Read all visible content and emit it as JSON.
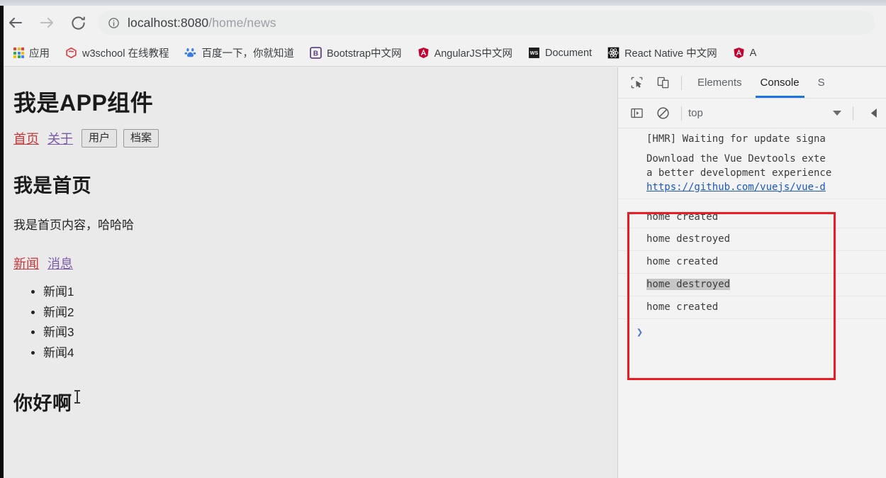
{
  "browser": {
    "back_label": "back-navigation",
    "forward_label": "forward-navigation",
    "reload_label": "reload",
    "url_host": "localhost:8080",
    "url_path": "/home/news",
    "url_full": "localhost:8080/home/news",
    "site_info_label": "site-information"
  },
  "bookmarks": [
    {
      "label": "应用",
      "icon": "apps-grid-icon"
    },
    {
      "label": "w3school 在线教程",
      "icon": "w3school-icon"
    },
    {
      "label": "百度一下，你就知道",
      "icon": "baidu-icon"
    },
    {
      "label": "Bootstrap中文网",
      "icon": "bootstrap-icon"
    },
    {
      "label": "AngularJS中文网",
      "icon": "angularjs-icon"
    },
    {
      "label": "Document",
      "icon": "ws-document-icon"
    },
    {
      "label": "React Native 中文网",
      "icon": "react-native-icon"
    },
    {
      "label": "A",
      "icon": "angularjs-icon"
    }
  ],
  "page": {
    "app_title": "我是APP组件",
    "nav_links": [
      {
        "label": "首页",
        "state": "visited-red"
      },
      {
        "label": "关于",
        "state": "visited-purple"
      }
    ],
    "nav_buttons": [
      {
        "label": "用户"
      },
      {
        "label": "档案"
      }
    ],
    "home_heading": "我是首页",
    "home_paragraph": "我是首页内容，哈哈哈",
    "sub_links": [
      {
        "label": "新闻",
        "state": "visited-red"
      },
      {
        "label": "消息",
        "state": "visited-purple"
      }
    ],
    "news_items": [
      "新闻1",
      "新闻2",
      "新闻3",
      "新闻4"
    ],
    "hello_heading": "你好啊"
  },
  "devtools": {
    "tabs": [
      {
        "label": "Elements",
        "active": false
      },
      {
        "label": "Console",
        "active": true
      },
      {
        "label": "S",
        "active": false
      }
    ],
    "inspect_icon": "inspect-element-icon",
    "device_toggle_icon": "device-toolbar-icon",
    "sidebar_toggle_icon": "console-sidebar-icon",
    "clear_icon": "clear-console-icon",
    "context_value": "top",
    "eye_icon": "console-settings-icon",
    "console": {
      "messages": [
        {
          "text": "[HMR] Waiting for update signa",
          "type": "info"
        },
        {
          "text": "Download the Vue Devtools exte",
          "type": "info"
        },
        {
          "text": "a better development experience",
          "type": "info"
        },
        {
          "text": "https://github.com/vuejs/vue-d",
          "type": "link"
        },
        {
          "text": "home created",
          "type": "log"
        },
        {
          "text": "home destroyed",
          "type": "log"
        },
        {
          "text": "home created",
          "type": "log"
        },
        {
          "text": "home destroyed",
          "type": "log",
          "selected": true
        },
        {
          "text": "home created",
          "type": "log"
        }
      ],
      "prompt_symbol": "❯"
    },
    "highlight_box_color": "#ec1c24"
  }
}
